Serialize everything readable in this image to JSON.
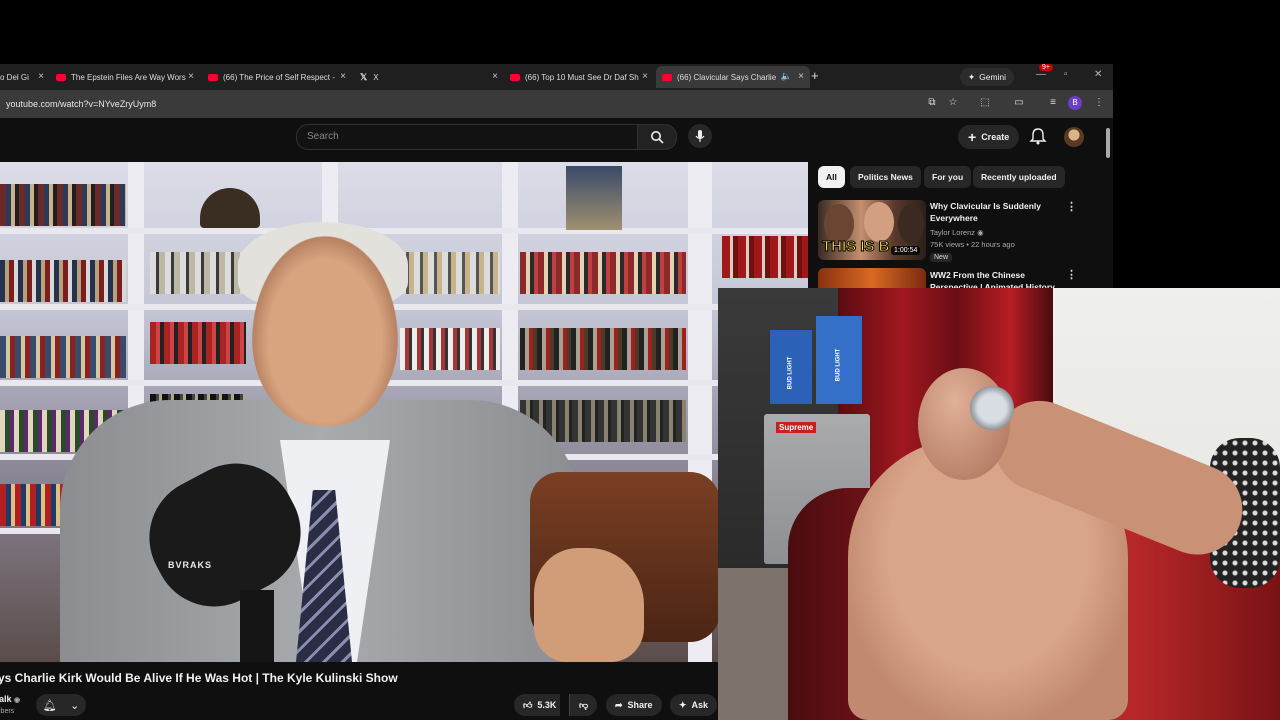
{
  "browser": {
    "tabs": [
      {
        "title": "o Del Gi",
        "active": false
      },
      {
        "title": "The Epstein Files Are Way Wors",
        "active": false
      },
      {
        "title": "(66) The Price of Self Respect -",
        "active": false
      },
      {
        "title": "X",
        "active": false
      },
      {
        "title": "(66) Top 10 Must See Dr Daf Sh",
        "active": false
      },
      {
        "title": "(66) Clavicular Says Charlie",
        "active": true
      }
    ],
    "new_tab_label": "+",
    "gemini_label": "Gemini",
    "url": "youtube.com/watch?v=NYveZryUym8",
    "profile_initial": "B"
  },
  "youtube": {
    "search_placeholder": "Search",
    "create_label": "Create",
    "notification_count": "9+",
    "chips": [
      "All",
      "Politics News",
      "For you",
      "Recently uploaded"
    ],
    "recommendations": [
      {
        "title": "Why Clavicular Is Suddenly Everywhere",
        "channel": "Taylor Lorenz",
        "meta": "75K views • 22 hours ago",
        "badge": "New",
        "duration": "1:00:54",
        "thumb_text": "THIS IS B"
      },
      {
        "title": "WW2 From the Chinese Perspective | Animated History",
        "channel": "",
        "meta": "",
        "badge": "",
        "duration": "",
        "thumb_text": ""
      }
    ],
    "video": {
      "title": "ys Charlie Kirk Would Be Alive If He Was Hot | The Kyle Kulinski Show",
      "channel_fragment": "alk",
      "subs_fragment": "ibers",
      "like_count": "5.3K",
      "share_label": "Share",
      "ask_label": "Ask",
      "mic_brand": "BVRAKS"
    }
  },
  "webcam_labels": {
    "box_brand": "BUD LIGHT",
    "fridge_brand": "Supreme"
  },
  "colors": {
    "youtube_red": "#ff0033",
    "bg": "#0f0f0f",
    "chip": "#272727"
  }
}
